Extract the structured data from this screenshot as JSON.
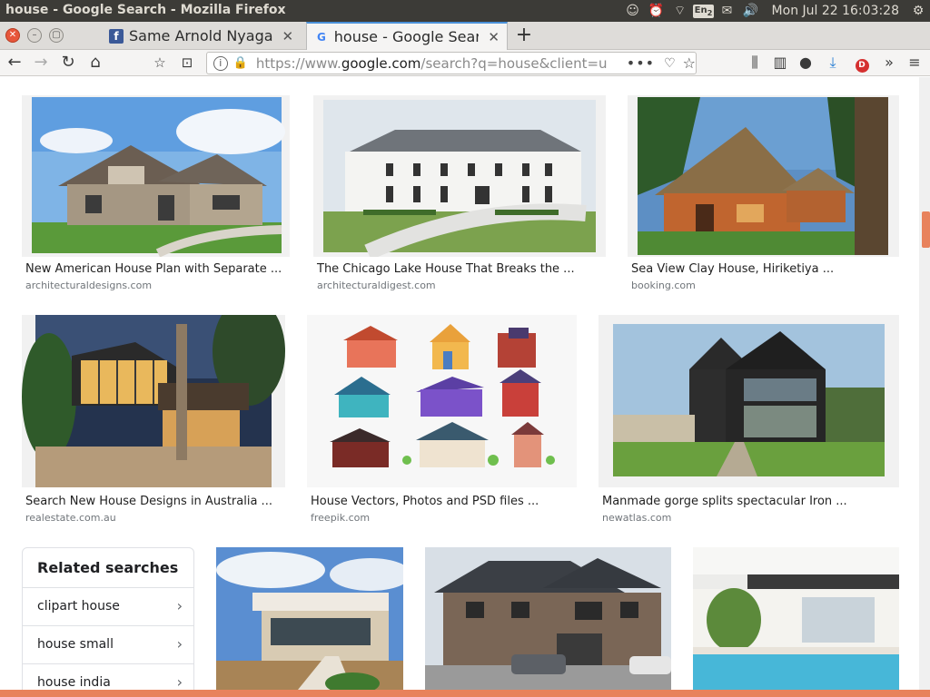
{
  "os": {
    "window_title": "house - Google Search - Mozilla Firefox",
    "lang": "En",
    "lang_sub": "2",
    "clock": "Mon Jul 22 16:03:28"
  },
  "tabs": [
    {
      "label": "Same Arnold Nyaga",
      "favicon": "f",
      "favicon_color": "#3b5998"
    },
    {
      "label": "house - Google Search",
      "favicon": "G",
      "favicon_color": "#4285f4"
    }
  ],
  "nav": {
    "url_prefix": "https://www.",
    "url_host": "google.com",
    "url_rest": "/search?q=house&client=u",
    "more": "•••"
  },
  "images": [
    {
      "title": "New American House Plan with Separate ...",
      "source": "architecturaldesigns.com"
    },
    {
      "title": "The Chicago Lake House That Breaks the ...",
      "source": "architecturaldigest.com"
    },
    {
      "title": "Sea View Clay House, Hiriketiya ...",
      "source": "booking.com"
    },
    {
      "title": "Search New House Designs in Australia ...",
      "source": "realestate.com.au"
    },
    {
      "title": "House Vectors, Photos and PSD files ...",
      "source": "freepik.com"
    },
    {
      "title": "Manmade gorge splits spectacular Iron ...",
      "source": "newatlas.com"
    }
  ],
  "related": {
    "heading": "Related searches",
    "items": [
      "clipart house",
      "house small",
      "house india"
    ]
  },
  "colors": {
    "accent": "#e8825c",
    "os_bar": "#3c3b37"
  }
}
